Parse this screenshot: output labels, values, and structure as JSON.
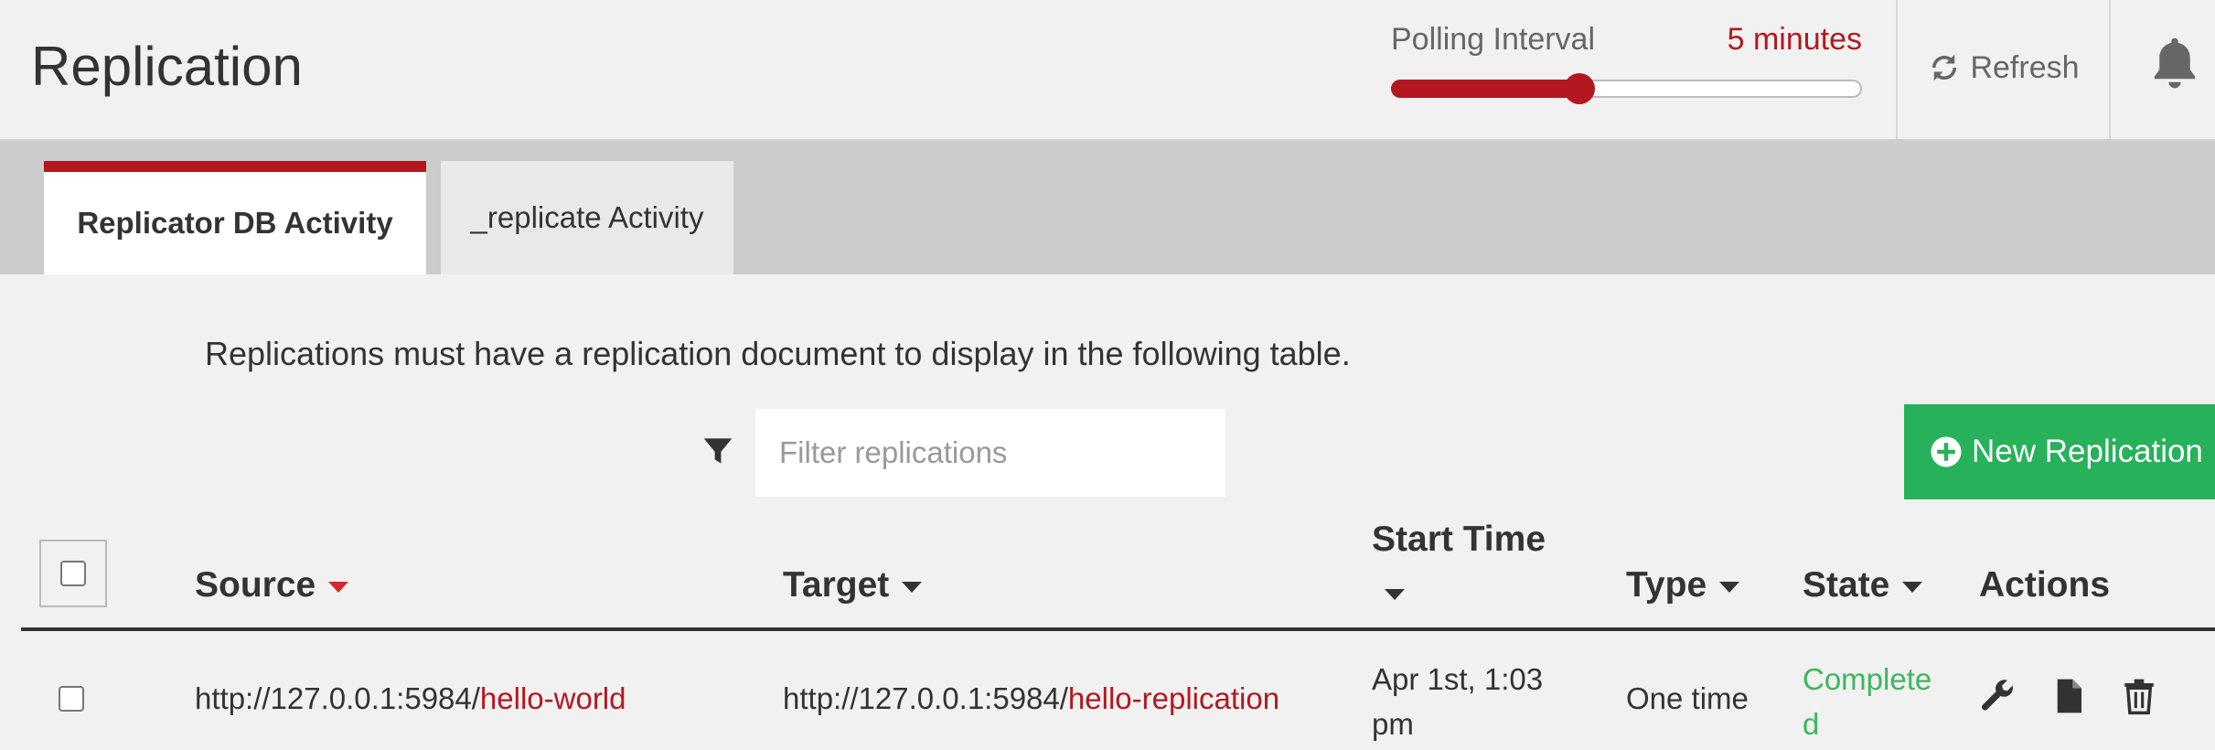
{
  "header": {
    "title": "Replication",
    "polling_label": "Polling Interval",
    "polling_value": "5 minutes",
    "polling_fraction": 0.4,
    "refresh_label": "Refresh",
    "bell_icon": "bell-icon"
  },
  "tabs": [
    {
      "label": "Replicator DB Activity",
      "active": true
    },
    {
      "label": "_replicate Activity",
      "active": false
    }
  ],
  "notice": "Replications must have a replication document to display in the following table.",
  "filter": {
    "placeholder": "Filter replications",
    "value": ""
  },
  "new_button": {
    "label": "New Replication"
  },
  "table": {
    "columns": {
      "source": "Source",
      "target": "Target",
      "start_time_line1": "Start Time",
      "type": "Type",
      "state": "State",
      "actions": "Actions"
    },
    "rows": [
      {
        "source_base": "http://127.0.0.1:5984/",
        "source_db": "hello-world",
        "target_base": "http://127.0.0.1:5984/",
        "target_db": "hello-replication",
        "start_line1": "Apr 1st, 1:03",
        "start_line2": "pm",
        "type": "One time",
        "state_line1": "Complete",
        "state_line2": "d"
      }
    ]
  },
  "colors": {
    "accent": "#b3181f",
    "success": "#27b15a",
    "state_text": "#3db65d",
    "tab_bar": "#cccccc"
  },
  "icons": [
    "refresh-icon",
    "bell-icon",
    "filter-icon",
    "plus-circle-icon",
    "wrench-icon",
    "document-icon",
    "trash-icon"
  ]
}
